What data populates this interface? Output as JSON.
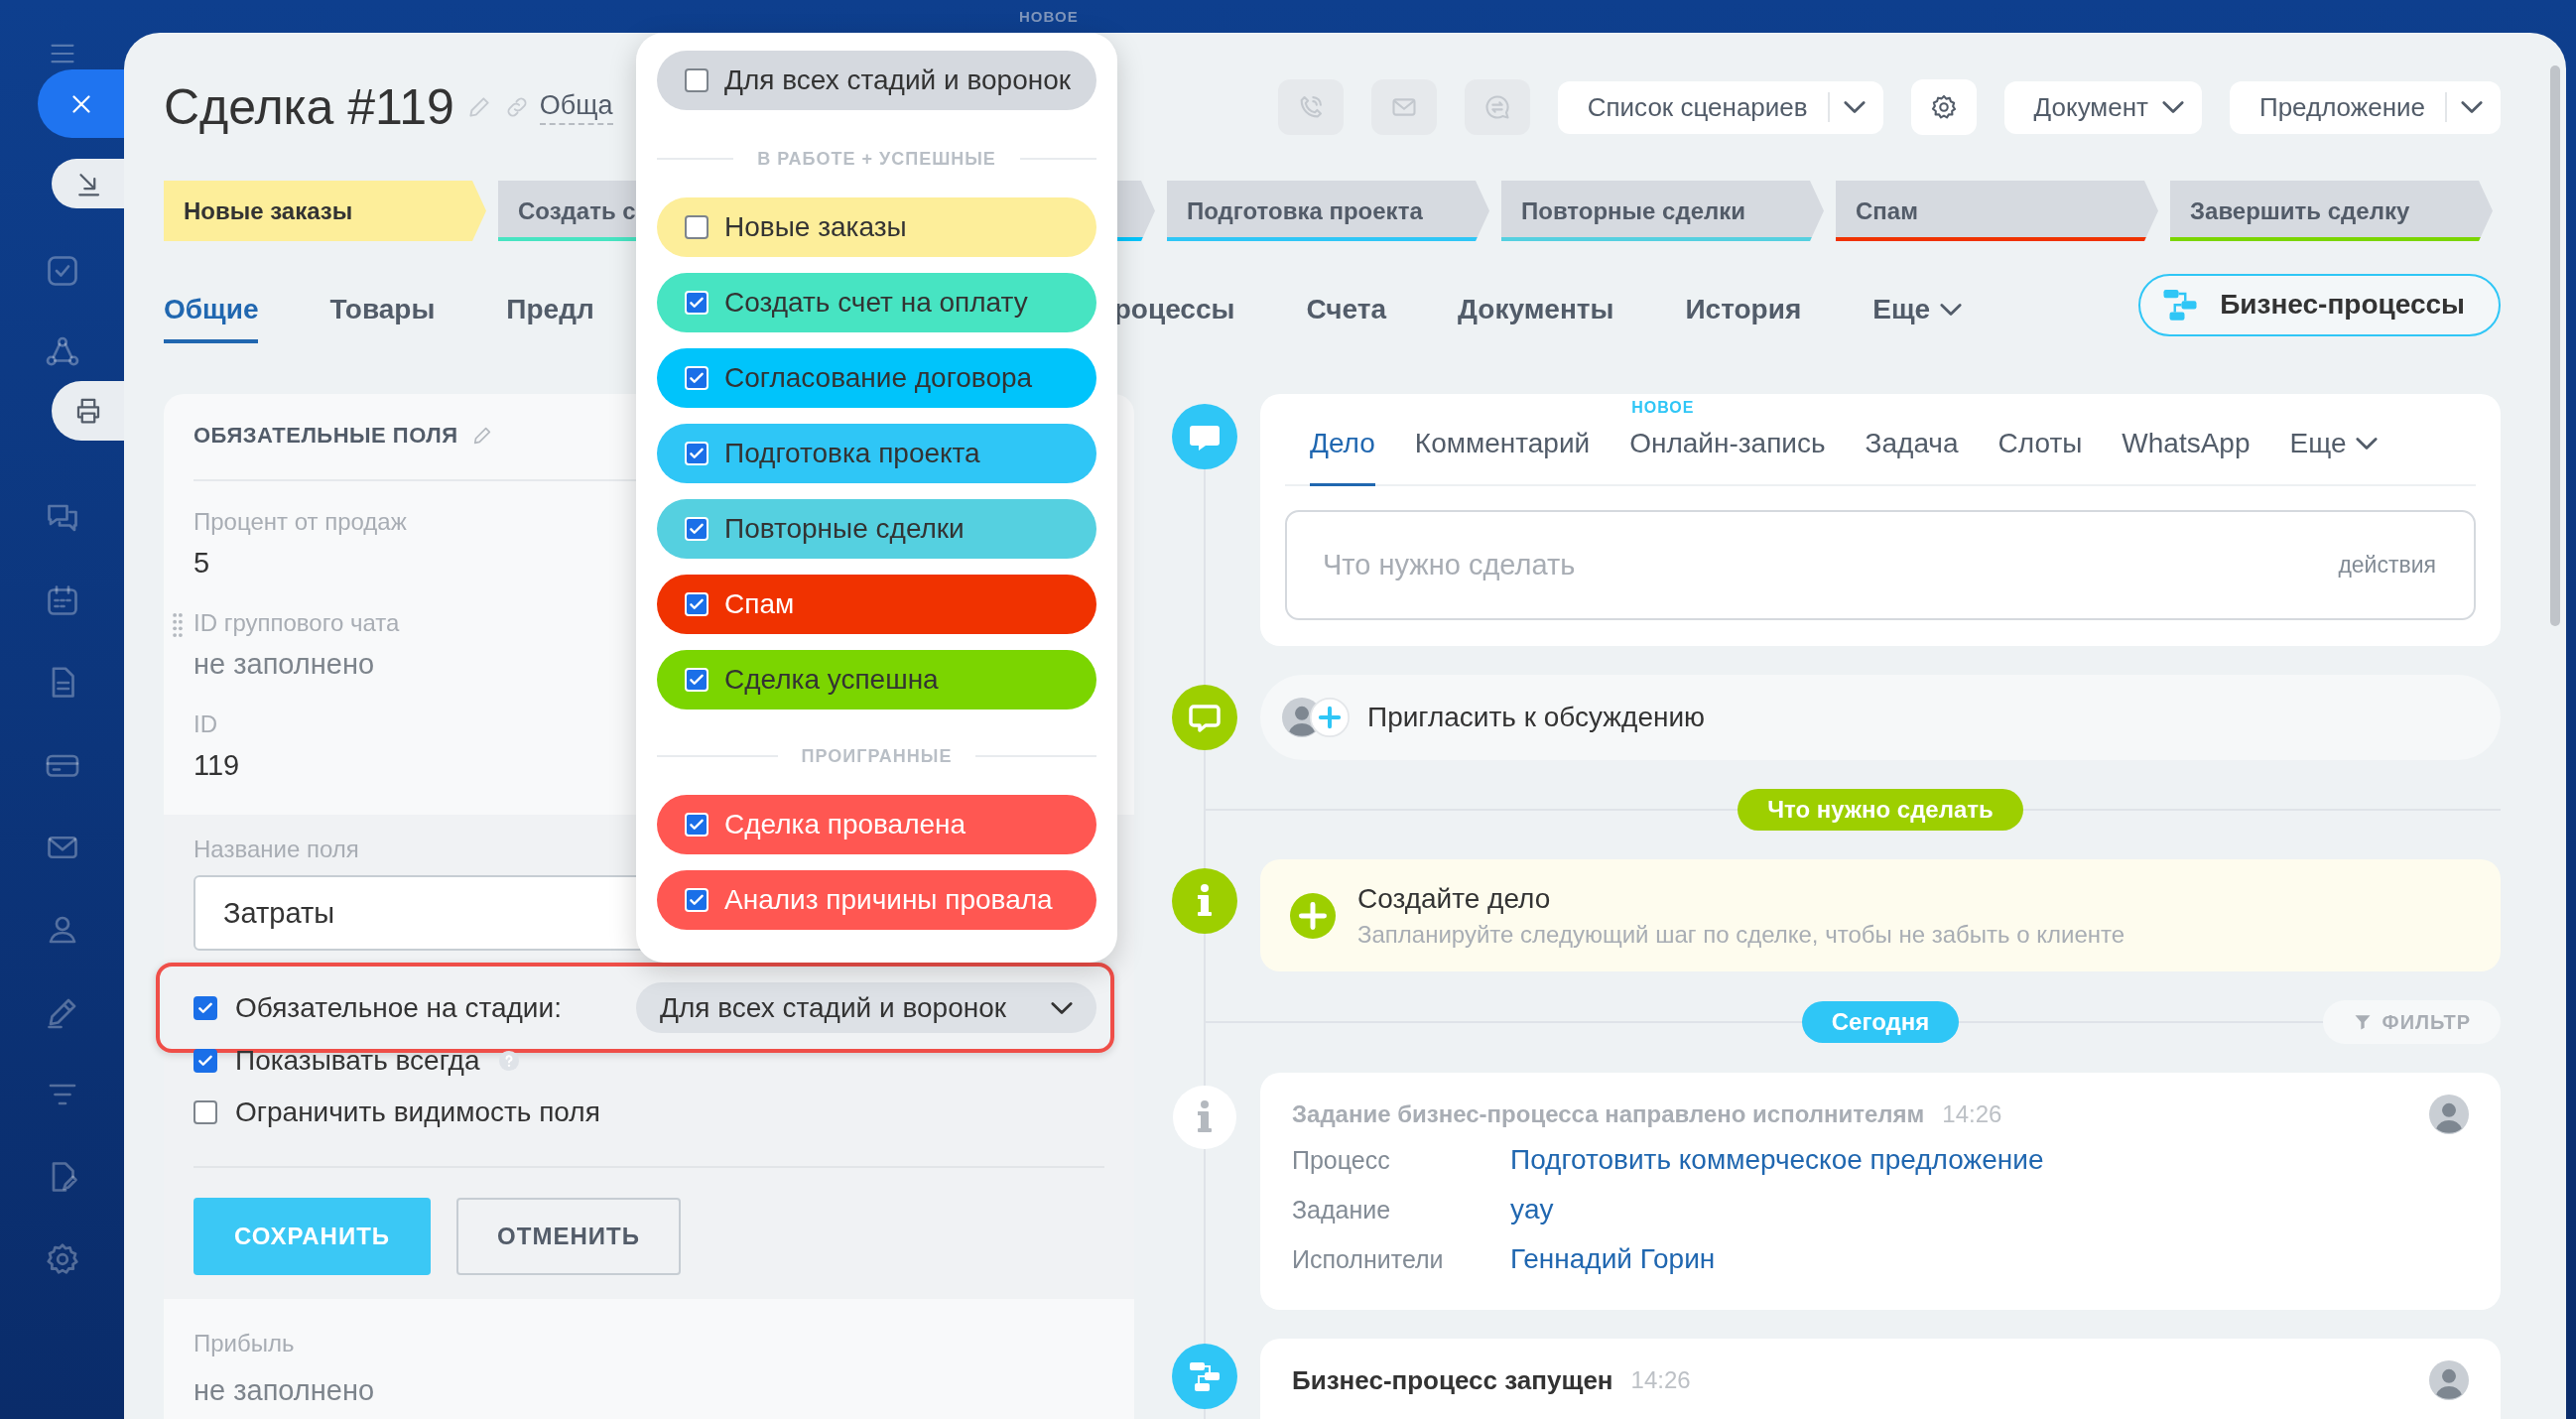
{
  "top_badge": "НОВОЕ",
  "header": {
    "title": "Сделка #119",
    "category": "Обща",
    "actions": [
      {
        "kind": "phone",
        "disabled": true
      },
      {
        "kind": "mail",
        "disabled": true
      },
      {
        "kind": "chat",
        "disabled": true
      },
      {
        "kind": "split",
        "label": "Список сценариев",
        "disabled": false
      },
      {
        "kind": "settings",
        "disabled": false
      },
      {
        "kind": "dropdown",
        "label": "Документ",
        "disabled": false
      },
      {
        "kind": "split",
        "label": "Предложение",
        "disabled": false
      }
    ]
  },
  "stages": [
    {
      "label": "Новые заказы",
      "color": "#fdee9a",
      "selected": true
    },
    {
      "label": "Создать с",
      "color": "#47e4c2",
      "selected": false
    },
    {
      "color": "#00c4fb",
      "selected": false
    },
    {
      "label": "Подготовка проекта",
      "color": "#2fc6f6",
      "selected": false
    },
    {
      "label": "Повторные сделки",
      "color": "#55d0e0",
      "selected": false
    },
    {
      "label": "Спам",
      "color": "#f03200",
      "selected": false
    },
    {
      "label": "Завершить сделку",
      "color": "#7bd500",
      "selected": false
    }
  ],
  "tabs": [
    {
      "label": "Общие",
      "kind": "tab",
      "selected": true
    },
    {
      "label": "Товары",
      "kind": "tab",
      "selected": false
    },
    {
      "label": "Предл",
      "kind": "tab",
      "selected": false
    },
    {
      "label": "роцессы",
      "kind": "tab",
      "selected": false
    },
    {
      "label": "Счета",
      "kind": "tab",
      "selected": false
    },
    {
      "label": "Документы",
      "kind": "tab",
      "selected": false
    },
    {
      "label": "История",
      "kind": "tab",
      "selected": false
    },
    {
      "label": "Еще",
      "kind": "more",
      "selected": false
    }
  ],
  "bp_button": "Бизнес-процессы",
  "required_fields": {
    "title": "ОБЯЗАТЕЛЬНЫЕ ПОЛЯ",
    "fields": [
      {
        "label": "Процент от продаж",
        "value": "5",
        "empty": false,
        "hovered": false
      },
      {
        "label": "ID группового чата",
        "value": "не заполнено",
        "empty": true,
        "hovered": true
      },
      {
        "label": "ID",
        "value": "119",
        "empty": false,
        "hovered": false
      }
    ],
    "editor": {
      "name_label": "Название поля",
      "name_value": "Затраты",
      "options": [
        {
          "kind": "stages",
          "label": "Обязательное на стадии:",
          "checked": true,
          "select": "Для всех стадий и воронок"
        },
        {
          "kind": "help",
          "label": "Показывать всегда",
          "checked": true
        },
        {
          "kind": "plain",
          "label": "Ограничить видимость поля",
          "checked": false
        }
      ],
      "save": "СОХРАНИТЬ",
      "cancel": "ОТМЕНИТЬ"
    },
    "after_fields": [
      {
        "label": "Прибыль",
        "value": "не заполнено",
        "empty": true
      }
    ]
  },
  "stage_menu": {
    "all": {
      "label": "Для всех стадий и воронок",
      "checked": false
    },
    "groups": [
      {
        "title": "В РАБОТЕ + УСПЕШНЫЕ",
        "items": [
          {
            "label": "Новые заказы",
            "color": "#fdee9a",
            "checked": false
          },
          {
            "label": "Создать счет на оплату",
            "color": "#47e4c2",
            "checked": true
          },
          {
            "label": "Согласование договора",
            "color": "#00c4fb",
            "checked": true
          },
          {
            "label": "Подготовка проекта",
            "color": "#2fc6f6",
            "checked": true
          },
          {
            "label": "Повторные сделки",
            "color": "#55d0e0",
            "checked": true
          },
          {
            "label": "Спам",
            "color": "#f03200",
            "checked": true
          },
          {
            "label": "Сделка успешна",
            "color": "#7bd500",
            "checked": true
          }
        ]
      },
      {
        "title": "ПРОИГРАННЫЕ",
        "items": [
          {
            "label": "Сделка провалена",
            "color": "#ff5752",
            "checked": true
          },
          {
            "label": "Анализ причины провала",
            "color": "#ff5752",
            "checked": true
          }
        ]
      }
    ]
  },
  "composer": {
    "tabs": [
      {
        "label": "Дело",
        "kind": "tab",
        "selected": true
      },
      {
        "label": "Комментарий",
        "kind": "tab",
        "selected": false
      },
      {
        "label": "Онлайн-запись",
        "kind": "tab",
        "selected": false,
        "badge": "НОВОЕ"
      },
      {
        "label": "Задача",
        "kind": "tab",
        "selected": false
      },
      {
        "label": "Слоты",
        "kind": "tab",
        "selected": false
      },
      {
        "label": "WhatsApp",
        "kind": "tab",
        "selected": false
      },
      {
        "label": "Еще",
        "kind": "more",
        "selected": false
      }
    ],
    "placeholder": "Что нужно сделать",
    "actions": "действия"
  },
  "invite": {
    "label": "Пригласить к обсуждению"
  },
  "timeline": [
    {
      "kind": "divider",
      "label": "Что нужно сделать",
      "color": "#9dcf00"
    },
    {
      "kind": "todo",
      "title": "Создайте дело",
      "subtitle": "Запланируйте следующий шаг по сделке, чтобы не забыть о клиенте"
    },
    {
      "kind": "divider",
      "label": "Сегодня",
      "color": "#2fc6f6",
      "filter": "ФИЛЬТР"
    },
    {
      "kind": "task",
      "title": "Задание бизнес-процесса направлено исполнителям",
      "time": "14:26",
      "rows": [
        {
          "label": "Процесс",
          "value": "Подготовить коммерческое предложение"
        },
        {
          "label": "Задание",
          "value": "yay"
        },
        {
          "label": "Исполнители",
          "value": "Геннадий Горин"
        }
      ]
    },
    {
      "kind": "started",
      "title": "Бизнес-процесс запущен",
      "time": "14:26"
    }
  ]
}
